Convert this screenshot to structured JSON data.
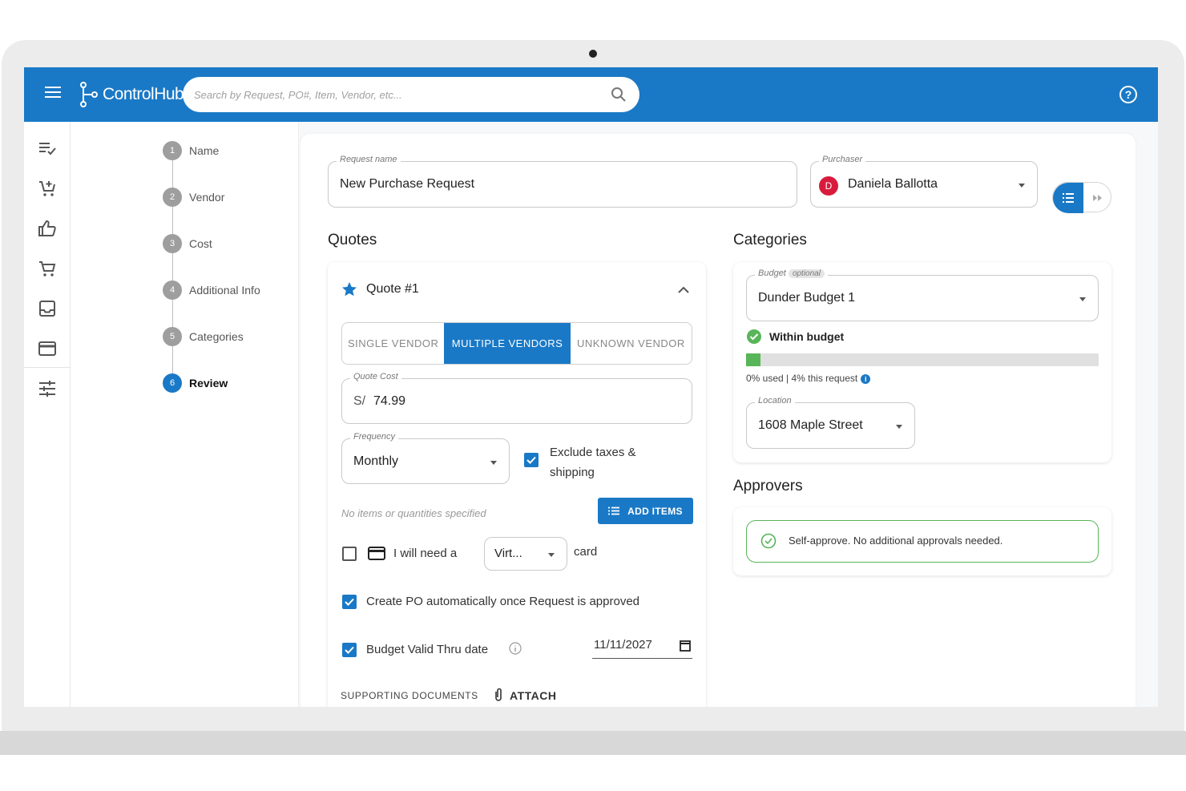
{
  "app": {
    "name": "ControlHub",
    "search_placeholder": "Search by Request, PO#, Item, Vendor, etc...",
    "accent_color": "#1a79c6"
  },
  "rail_icons": [
    "checklist-icon",
    "add-cart-icon",
    "thumbs-up-icon",
    "cart-icon",
    "inbox-icon",
    "credit-card-icon",
    "tune-icon"
  ],
  "steps": [
    {
      "num": "1",
      "label": "Name",
      "active": false
    },
    {
      "num": "2",
      "label": "Vendor",
      "active": false
    },
    {
      "num": "3",
      "label": "Cost",
      "active": false
    },
    {
      "num": "4",
      "label": "Additional Info",
      "active": false
    },
    {
      "num": "5",
      "label": "Categories",
      "active": false
    },
    {
      "num": "6",
      "label": "Review",
      "active": true
    }
  ],
  "request": {
    "name_label": "Request name",
    "name_value": "New Purchase Request",
    "purchaser_label": "Purchaser",
    "purchaser_initial": "D",
    "purchaser_value": "Daniela Ballotta"
  },
  "quotes": {
    "title": "Quotes",
    "quote_title": "Quote #1",
    "vendor_modes": [
      "SINGLE VENDOR",
      "MULTIPLE VENDORS",
      "UNKNOWN VENDOR"
    ],
    "active_mode": "MULTIPLE VENDORS",
    "cost_label": "Quote Cost",
    "cost_currency": "S/",
    "cost_value": "74.99",
    "frequency_label": "Frequency",
    "frequency_value": "Monthly",
    "exclude_taxes_label": "Exclude taxes & shipping",
    "exclude_taxes_checked": true,
    "no_items_text": "No items or quantities specified",
    "add_items_label": "ADD ITEMS",
    "card_need_prefix": "I will need a",
    "card_type_value": "Virt...",
    "card_suffix": "card",
    "card_need_checked": false,
    "create_po_label": "Create PO automatically once Request is approved",
    "create_po_checked": true,
    "budget_valid_label": "Budget Valid Thru date",
    "budget_valid_checked": true,
    "budget_valid_date": "11/11/2027",
    "supporting_docs_label": "SUPPORTING DOCUMENTS",
    "attach_label": "ATTACH"
  },
  "categories": {
    "title": "Categories",
    "budget_label": "Budget",
    "budget_optional": "optional",
    "budget_value": "Dunder Budget 1",
    "status_text": "Within budget",
    "usage_text": "0% used | 4% this request",
    "used_fraction": 0.04,
    "location_label": "Location",
    "location_value": "1608 Maple Street"
  },
  "approvers": {
    "title": "Approvers",
    "message": "Self-approve. No additional approvals needed."
  }
}
